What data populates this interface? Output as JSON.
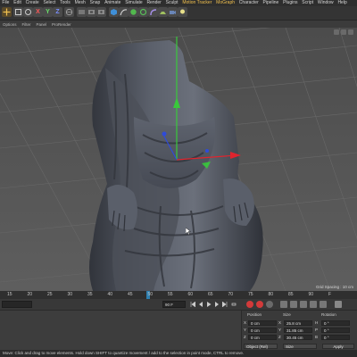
{
  "menu": {
    "items": [
      "File",
      "Edit",
      "Create",
      "Select",
      "Tools",
      "Mesh",
      "Snap",
      "Animate",
      "Simulate",
      "Render",
      "Sculpt",
      "Motion Tracker",
      "MoGraph",
      "Character",
      "Pipeline",
      "Plugins",
      "Script",
      "Window",
      "Help"
    ],
    "highlight_color": "#f2c14e"
  },
  "toolbar": {
    "axis_x": "X",
    "axis_y": "Y",
    "axis_z": "Z"
  },
  "viewport_menu": {
    "items": [
      "Options",
      "Filter",
      "Panel",
      "ProRender"
    ]
  },
  "viewport": {
    "grid_spacing": "Grid Spacing : 10 cm",
    "axis_colors": {
      "x": "#e0242e",
      "y": "#39c93b",
      "z": "#2f4bd8"
    }
  },
  "timeline": {
    "ticks": [
      "15",
      "20",
      "25",
      "30",
      "35",
      "40",
      "45",
      "50",
      "55",
      "60",
      "65",
      "70",
      "75",
      "80",
      "85",
      "90",
      "F"
    ],
    "playhead_frame": 50,
    "end_frame_field": "90 F"
  },
  "coordinates": {
    "headers": {
      "position": "Position",
      "size": "Size",
      "rotation": "Rotation"
    },
    "rows": [
      {
        "axis": "X",
        "position": "0 cm",
        "size_axis": "X",
        "size": "25.8 cm",
        "rot_axis": "H",
        "rotation": "0 °"
      },
      {
        "axis": "Y",
        "position": "0 cm",
        "size_axis": "Y",
        "size": "31.85 cm",
        "rot_axis": "P",
        "rotation": "0 °"
      },
      {
        "axis": "Z",
        "position": "0 cm",
        "size_axis": "Z",
        "size": "30.45 cm",
        "rot_axis": "B",
        "rotation": "0 °"
      }
    ],
    "mode_select": "Object (Rel)",
    "size_select": "Size",
    "apply_label": "Apply"
  },
  "status": {
    "text": "Move: Click and drag to move elements. Hold down SHIFT to quantize movement / add to the selection in point mode, CTRL to remove."
  }
}
